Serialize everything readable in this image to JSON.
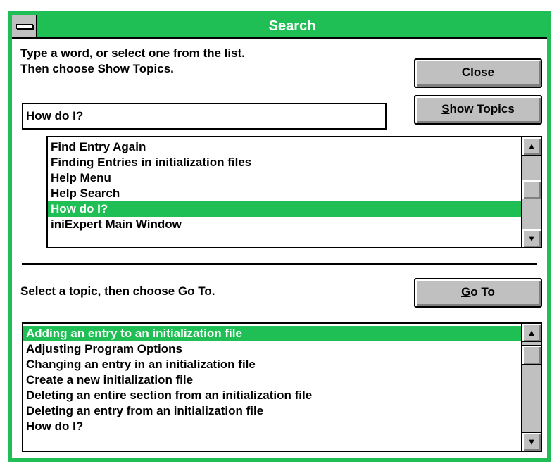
{
  "window": {
    "title": "Search"
  },
  "instructions": {
    "line1_pre": "Type a ",
    "line1_key": "w",
    "line1_post": "ord, or select one from the list.",
    "line2": "Then choose Show Topics."
  },
  "buttons": {
    "close": "Close",
    "show_topics_key": "S",
    "show_topics_rest": "how Topics",
    "goto_key": "G",
    "goto_rest": "o To"
  },
  "search": {
    "value": "How do I?"
  },
  "keywords": [
    {
      "label": "Find Entry Again",
      "selected": false
    },
    {
      "label": "Finding Entries in initialization files",
      "selected": false
    },
    {
      "label": "Help Menu",
      "selected": false
    },
    {
      "label": "Help Search",
      "selected": false
    },
    {
      "label": "How do I?",
      "selected": true
    },
    {
      "label": "iniExpert Main Window",
      "selected": false
    }
  ],
  "topic_prompt": {
    "pre": "Select a ",
    "key": "t",
    "post": "opic, then choose Go To."
  },
  "topics": [
    {
      "label": "Adding an entry to an initialization file",
      "selected": true
    },
    {
      "label": "Adjusting Program Options",
      "selected": false
    },
    {
      "label": "Changing an entry in an initialization file",
      "selected": false
    },
    {
      "label": "Create a new initialization file",
      "selected": false
    },
    {
      "label": "Deleting an entire section from an initialization file",
      "selected": false
    },
    {
      "label": "Deleting an entry from an initialization file",
      "selected": false
    },
    {
      "label": "How do I?",
      "selected": false
    }
  ],
  "scrollbars": {
    "up_icon": "arrow-up-icon",
    "down_icon": "arrow-down-icon"
  },
  "colors": {
    "accent": "#1fbf55",
    "face": "#c0c0c0"
  }
}
